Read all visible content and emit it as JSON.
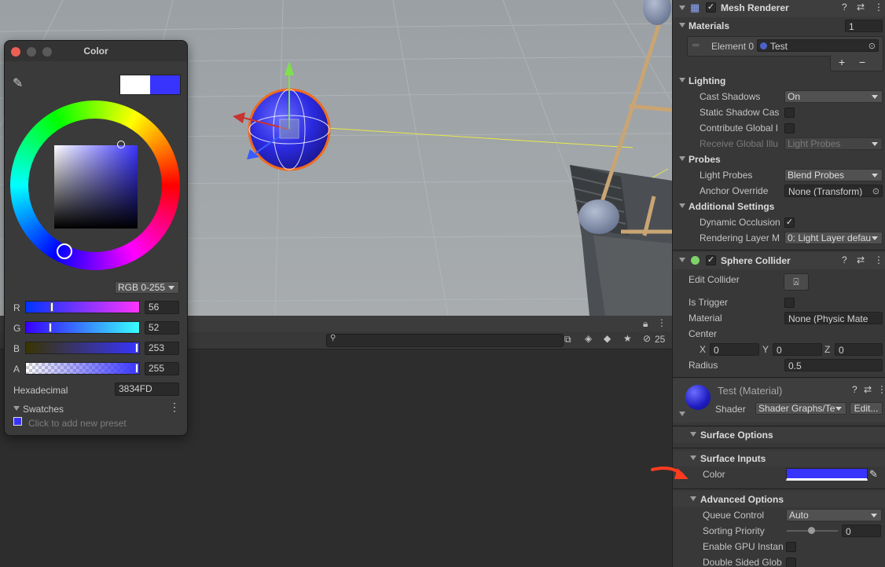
{
  "colors": {
    "accent": "#3834FD",
    "arrow": "#ff3b1f"
  },
  "picker": {
    "title": "Color",
    "mode": "RGB 0-255",
    "r_label": "R",
    "r_value": "56",
    "g_label": "G",
    "g_value": "52",
    "b_label": "B",
    "b_value": "253",
    "a_label": "A",
    "a_value": "255",
    "hex_label": "Hexadecimal",
    "hex_value": "3834FD",
    "swatches_label": "Swatches",
    "swatch_hint": "Click to add new preset"
  },
  "lower": {
    "hidden_count": "25"
  },
  "inspector": {
    "mesh_renderer": {
      "title": "Mesh Renderer",
      "materials_label": "Materials",
      "materials_count": "1",
      "element_label": "Element 0",
      "element_value": "Test",
      "add": "+",
      "remove": "−",
      "lighting": "Lighting",
      "cast_shadows_label": "Cast Shadows",
      "cast_shadows_value": "On",
      "static_shadow_label": "Static Shadow Cas",
      "contribute_gi_label": "Contribute Global I",
      "receive_gi_label": "Receive Global Illu",
      "receive_gi_value": "Light Probes",
      "probes": "Probes",
      "light_probes_label": "Light Probes",
      "light_probes_value": "Blend Probes",
      "anchor_label": "Anchor Override",
      "anchor_value": "None (Transform)",
      "additional": "Additional Settings",
      "dynamic_occ_label": "Dynamic Occlusion",
      "rendering_layer_label": "Rendering Layer M",
      "rendering_layer_value": "0: Light Layer defau"
    },
    "sphere_collider": {
      "title": "Sphere Collider",
      "edit_label": "Edit Collider",
      "trigger_label": "Is Trigger",
      "material_label": "Material",
      "material_value": "None (Physic Mate",
      "center_label": "Center",
      "x_label": "X",
      "x_value": "0",
      "y_label": "Y",
      "y_value": "0",
      "z_label": "Z",
      "z_value": "0",
      "radius_label": "Radius",
      "radius_value": "0.5"
    },
    "material": {
      "title": "Test (Material)",
      "shader_label": "Shader",
      "shader_value": "Shader Graphs/Te",
      "edit_button": "Edit...",
      "surface_options": "Surface Options",
      "surface_inputs": "Surface Inputs",
      "color_label": "Color",
      "advanced": "Advanced Options",
      "queue_label": "Queue Control",
      "queue_value": "Auto",
      "sorting_label": "Sorting Priority",
      "sorting_value": "0",
      "gpu_label": "Enable GPU Instan",
      "double_label": "Double Sided Glob"
    }
  }
}
